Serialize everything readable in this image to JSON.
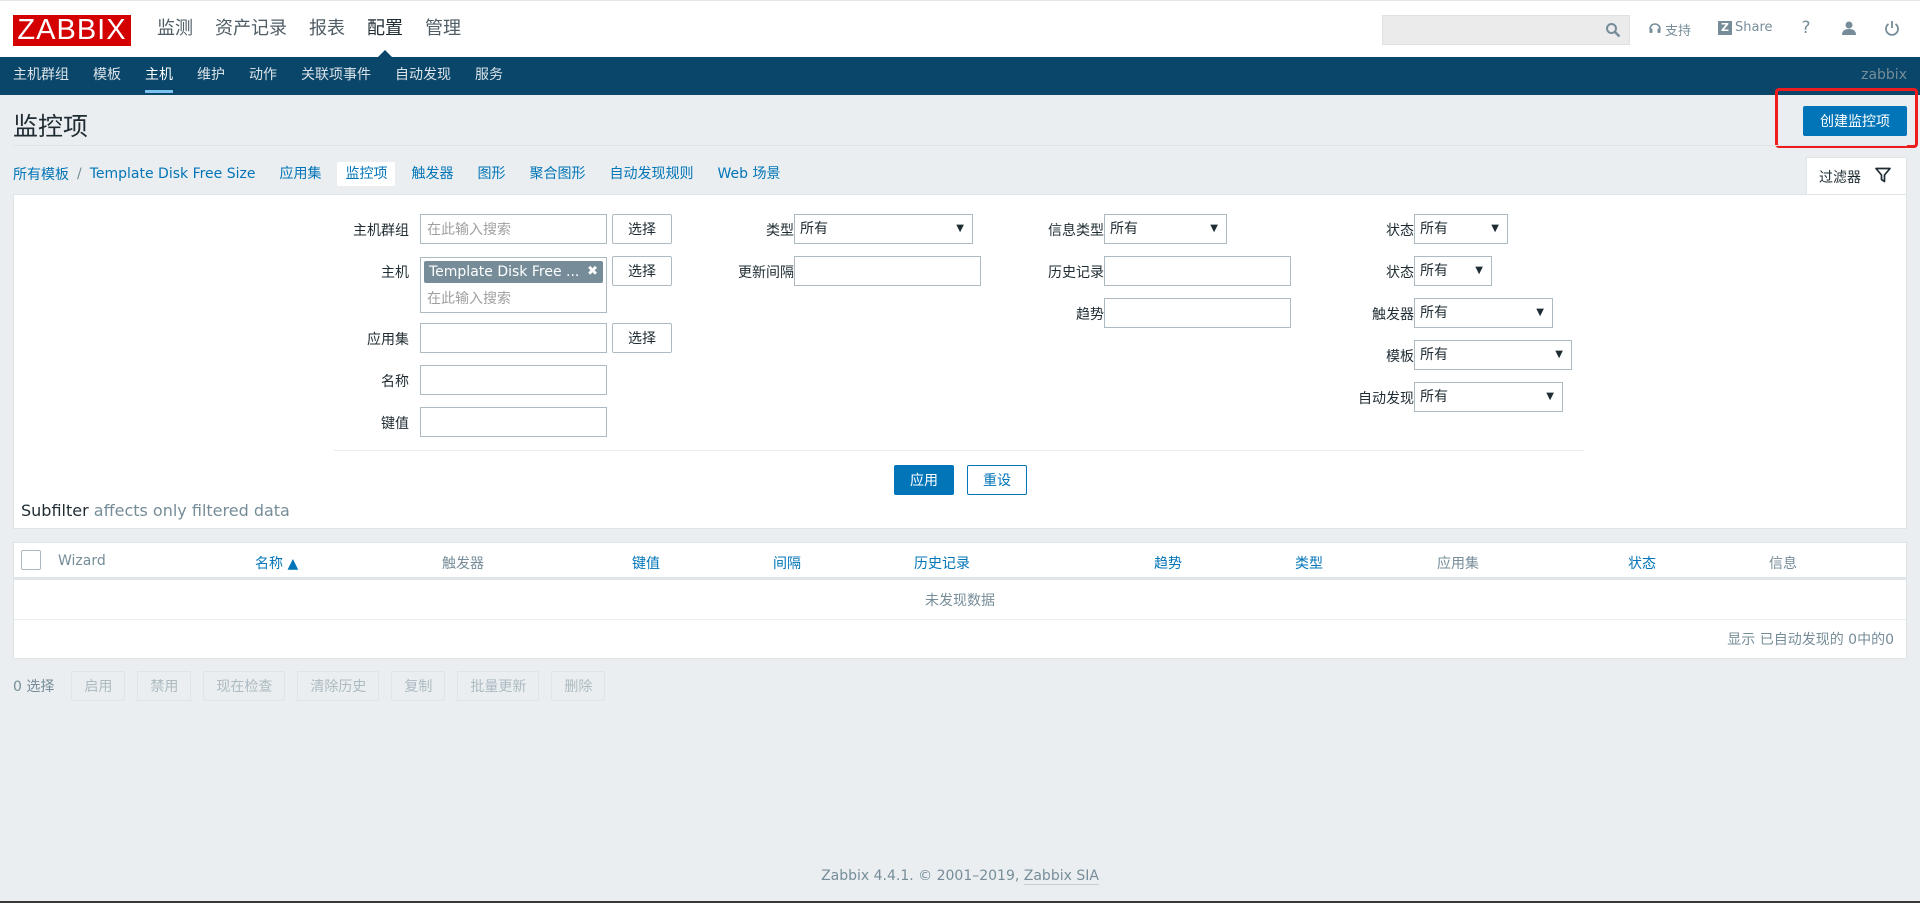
{
  "header": {
    "logo": "ZABBIX",
    "main_menu": [
      {
        "label": "监测",
        "active": false
      },
      {
        "label": "资产记录",
        "active": false
      },
      {
        "label": "报表",
        "active": false
      },
      {
        "label": "配置",
        "active": true
      },
      {
        "label": "管理",
        "active": false
      }
    ],
    "search": {
      "value": "",
      "placeholder": ""
    },
    "support_label": "支持",
    "share_label": "Share",
    "share_badge": "Z",
    "help_glyph": "?"
  },
  "sub_nav": {
    "items": [
      {
        "label": "主机群组",
        "active": false
      },
      {
        "label": "模板",
        "active": false
      },
      {
        "label": "主机",
        "active": true
      },
      {
        "label": "维护",
        "active": false
      },
      {
        "label": "动作",
        "active": false
      },
      {
        "label": "关联项事件",
        "active": false
      },
      {
        "label": "自动发现",
        "active": false
      },
      {
        "label": "服务",
        "active": false
      }
    ],
    "user": "zabbix"
  },
  "page": {
    "title": "监控项",
    "create_button": "创建监控项"
  },
  "breadcrumb": {
    "items": [
      "所有模板",
      "Template Disk Free Size"
    ],
    "separator": "/"
  },
  "object_tabs": [
    {
      "label": "应用集",
      "selected": false
    },
    {
      "label": "监控项",
      "selected": true
    },
    {
      "label": "触发器",
      "selected": false
    },
    {
      "label": "图形",
      "selected": false
    },
    {
      "label": "聚合图形",
      "selected": false
    },
    {
      "label": "自动发现规则",
      "selected": false
    },
    {
      "label": "Web 场景",
      "selected": false
    }
  ],
  "filter": {
    "tab_label": "过滤器",
    "host_group": {
      "label": "主机群组",
      "placeholder": "在此输入搜索",
      "select": "选择"
    },
    "host": {
      "label": "主机",
      "chip": "Template Disk Free ...",
      "placeholder": "在此输入搜索",
      "select": "选择"
    },
    "application": {
      "label": "应用集",
      "value": "",
      "select": "选择"
    },
    "name": {
      "label": "名称",
      "value": ""
    },
    "key": {
      "label": "键值",
      "value": ""
    },
    "type": {
      "label": "类型",
      "value": "所有"
    },
    "update_interval": {
      "label": "更新间隔",
      "value": ""
    },
    "info_type": {
      "label": "信息类型",
      "value": "所有"
    },
    "history": {
      "label": "历史记录",
      "value": ""
    },
    "trends": {
      "label": "趋势",
      "value": ""
    },
    "state": {
      "label": "状态",
      "value": "所有"
    },
    "status": {
      "label": "状态",
      "value": "所有"
    },
    "triggers": {
      "label": "触发器",
      "value": "所有"
    },
    "template": {
      "label": "模板",
      "value": "所有"
    },
    "discovery": {
      "label": "自动发现",
      "value": "所有"
    },
    "apply": "应用",
    "reset": "重设",
    "subfilter_title": "Subfilter",
    "subfilter_note": "affects only filtered data"
  },
  "table": {
    "columns": [
      {
        "label": "Wizard",
        "sortable": false
      },
      {
        "label": "名称 ▲",
        "sortable": true
      },
      {
        "label": "触发器",
        "sortable": false
      },
      {
        "label": "键值",
        "sortable": true
      },
      {
        "label": "间隔",
        "sortable": true
      },
      {
        "label": "历史记录",
        "sortable": true
      },
      {
        "label": "趋势",
        "sortable": true
      },
      {
        "label": "类型",
        "sortable": true
      },
      {
        "label": "应用集",
        "sortable": false
      },
      {
        "label": "状态",
        "sortable": true
      },
      {
        "label": "信息",
        "sortable": false
      }
    ],
    "empty_message": "未发现数据",
    "paging": "显示 已自动发现的 0中的0"
  },
  "actions": {
    "selected_count": "0 选择",
    "buttons": [
      "启用",
      "禁用",
      "现在检查",
      "清除历史",
      "复制",
      "批量更新",
      "删除"
    ]
  },
  "footer": {
    "text": "Zabbix 4.4.1. © 2001–2019, ",
    "link": "Zabbix SIA"
  },
  "colors": {
    "brand": "#d40000",
    "nav_bg": "#0a466a",
    "accent": "#0275b8",
    "highlight_box": "#ee1c1c"
  }
}
